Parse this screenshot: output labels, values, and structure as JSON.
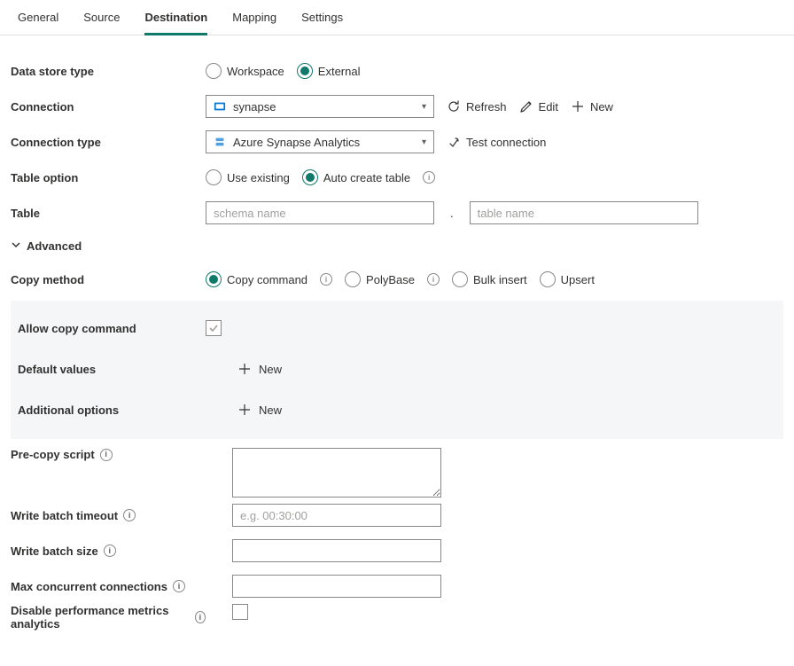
{
  "tabs": {
    "general": "General",
    "source": "Source",
    "destination": "Destination",
    "mapping": "Mapping",
    "settings": "Settings",
    "active": "destination"
  },
  "labels": {
    "data_store_type": "Data store type",
    "connection": "Connection",
    "connection_type": "Connection type",
    "table_option": "Table option",
    "table": "Table",
    "advanced": "Advanced",
    "copy_method": "Copy method",
    "allow_copy_command": "Allow copy command",
    "default_values": "Default values",
    "additional_options": "Additional options",
    "pre_copy_script": "Pre-copy script",
    "write_batch_timeout": "Write batch timeout",
    "write_batch_size": "Write batch size",
    "max_concurrent": "Max concurrent connections",
    "disable_metrics": "Disable performance metrics analytics"
  },
  "data_store_type": {
    "workspace": "Workspace",
    "external": "External",
    "selected": "external"
  },
  "connection": {
    "value": "synapse",
    "refresh": "Refresh",
    "edit": "Edit",
    "new": "New"
  },
  "connection_type": {
    "value": "Azure Synapse Analytics",
    "test": "Test connection"
  },
  "table_option": {
    "use_existing": "Use existing",
    "auto_create": "Auto create table",
    "selected": "auto_create"
  },
  "table": {
    "schema_placeholder": "schema name",
    "name_placeholder": "table name"
  },
  "copy_method": {
    "copy_command": "Copy command",
    "polybase": "PolyBase",
    "bulk_insert": "Bulk insert",
    "upsert": "Upsert",
    "selected": "copy_command"
  },
  "buttons": {
    "new": "New"
  },
  "placeholders": {
    "batch_timeout": "e.g. 00:30:00"
  }
}
